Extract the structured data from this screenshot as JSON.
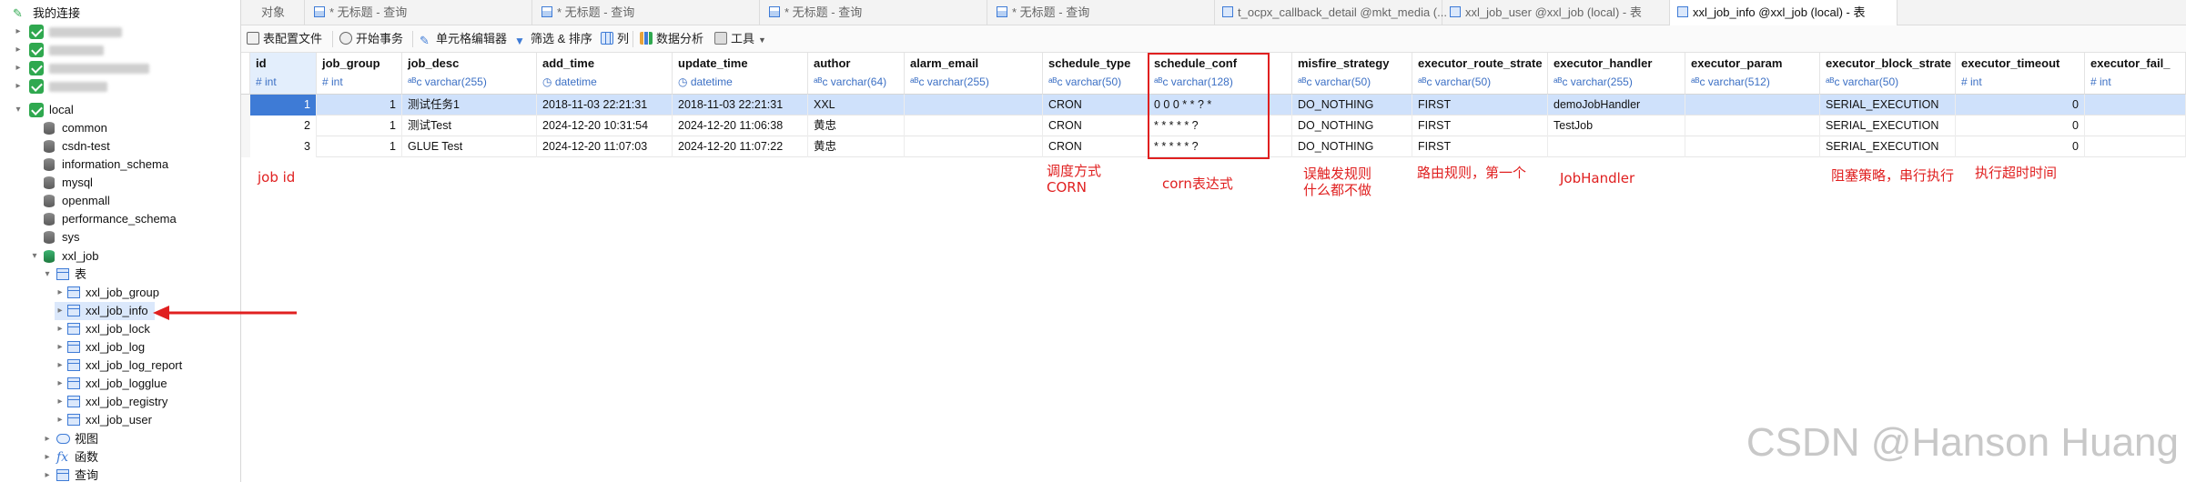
{
  "sidebar": {
    "root_label": "我的连接",
    "local_label": "local",
    "local_databases": [
      "common",
      "csdn-test",
      "information_schema",
      "mysql",
      "openmall",
      "performance_schema",
      "sys"
    ],
    "xxl_job_label": "xxl_job",
    "tables_folder_label": "表",
    "tables": [
      "xxl_job_group",
      "xxl_job_info",
      "xxl_job_lock",
      "xxl_job_log",
      "xxl_job_log_report",
      "xxl_job_logglue",
      "xxl_job_registry",
      "xxl_job_user"
    ],
    "views_label": "视图",
    "functions_label": "函数",
    "queries_label": "查询"
  },
  "tabs": {
    "objects": "对象",
    "untitled_1": "* 无标题 - 查询",
    "untitled_2": "* 无标题 - 查询",
    "untitled_3": "* 无标题 - 查询",
    "untitled_4": "* 无标题 - 查询",
    "callback": "t_ocpx_callback_detail @mkt_media (...",
    "job_user": "xxl_job_user @xxl_job (local) - 表",
    "job_info": "xxl_job_info @xxl_job (local) - 表"
  },
  "toolbar": {
    "table_config_file": "表配置文件",
    "begin_transaction": "开始事务",
    "cell_editor": "单元格编辑器",
    "filter_sort": "筛选 & 排序",
    "columns": "列",
    "data_analysis": "数据分析",
    "tools": "工具"
  },
  "columns": [
    {
      "name": "id",
      "type": "int"
    },
    {
      "name": "job_group",
      "type": "int"
    },
    {
      "name": "job_desc",
      "type": "varchar(255)"
    },
    {
      "name": "add_time",
      "type": "datetime"
    },
    {
      "name": "update_time",
      "type": "datetime"
    },
    {
      "name": "author",
      "type": "varchar(64)"
    },
    {
      "name": "alarm_email",
      "type": "varchar(255)"
    },
    {
      "name": "schedule_type",
      "type": "varchar(50)"
    },
    {
      "name": "schedule_conf",
      "type": "varchar(128)"
    },
    {
      "name": "misfire_strategy",
      "type": "varchar(50)"
    },
    {
      "name": "executor_route_strate",
      "type": "varchar(50)"
    },
    {
      "name": "executor_handler",
      "type": "varchar(255)"
    },
    {
      "name": "executor_param",
      "type": "varchar(512)"
    },
    {
      "name": "executor_block_strate",
      "type": "varchar(50)"
    },
    {
      "name": "executor_timeout",
      "type": "int"
    },
    {
      "name": "executor_fail_",
      "type": "int"
    }
  ],
  "rows": [
    [
      "1",
      "1",
      "测试任务1",
      "2018-11-03 22:21:31",
      "2018-11-03 22:21:31",
      "XXL",
      "",
      "CRON",
      "0 0 0 * * ? *",
      "DO_NOTHING",
      "FIRST",
      "demoJobHandler",
      "",
      "SERIAL_EXECUTION",
      "0",
      ""
    ],
    [
      "2",
      "1",
      "测试Test",
      "2024-12-20 10:31:54",
      "2024-12-20 11:06:38",
      "黄忠",
      "",
      "CRON",
      "* * * * * ?",
      "DO_NOTHING",
      "FIRST",
      "TestJob",
      "",
      "SERIAL_EXECUTION",
      "0",
      ""
    ],
    [
      "3",
      "1",
      "GLUE Test",
      "2024-12-20 11:07:03",
      "2024-12-20 11:07:22",
      "黄忠",
      "",
      "CRON",
      "* * * * * ?",
      "DO_NOTHING",
      "FIRST",
      "",
      "",
      "SERIAL_EXECUTION",
      "0",
      ""
    ]
  ],
  "annotations": {
    "job_id": "job id",
    "schedule_type_line1": "调度方式",
    "schedule_type_line2": "CORN",
    "cron_expr": "corn表达式",
    "misfire_line1": "误触发规则",
    "misfire_line2": "什么都不做",
    "route": "路由规则，第一个",
    "handler": "JobHandler",
    "block": "阻塞策略，串行执行",
    "timeout": "执行超时时间"
  },
  "watermark": "CSDN @Hanson Huang",
  "colors": {
    "annotation": "#e02020",
    "selection": "#3e7bd6",
    "type_text": "#3b6fc4"
  }
}
